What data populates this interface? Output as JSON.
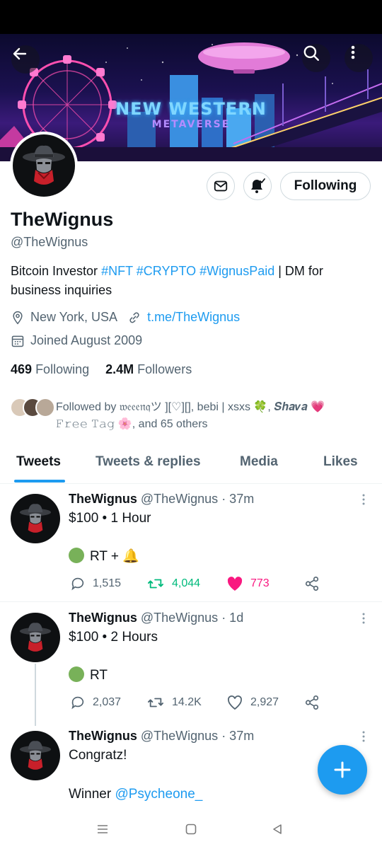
{
  "banner": {
    "title": "NEW WESTERN",
    "subtitle": "METAVERSE"
  },
  "header": {
    "back_icon": "arrow-left-icon",
    "search_icon": "search-icon",
    "more_icon": "more-vertical-icon"
  },
  "profile": {
    "name": "TheWignus",
    "handle": "@TheWignus",
    "follow_button": "Following",
    "bio": {
      "prefix": "Bitcoin Investor ",
      "tags": [
        "#NFT",
        "#CRYPTO",
        "#WignusPaid"
      ],
      "suffix": " | DM for business inquiries"
    },
    "location": "New York, USA",
    "website": "t.me/TheWignus",
    "joined": "Joined August 2009",
    "following_count": "469",
    "following_label": "Following",
    "followers_count": "2.4M",
    "followers_label": "Followers",
    "followed_by": {
      "prefix": "Followed by ",
      "name1": "𝔴𝔢𝔢𝔢𝔫𝔮ツ ][♡][]",
      "name2": "bebi | xsxs 🍀",
      "name3": "𝑺𝒉𝒂𝒗𝒂 💗",
      "name4": "𝙵𝚛𝚎𝚎 𝚃𝚊𝚐 🌸",
      "suffix": ", and 65 others"
    }
  },
  "tabs": [
    "Tweets",
    "Tweets & replies",
    "Media",
    "Likes"
  ],
  "tweets": [
    {
      "name": "TheWignus",
      "handle": "@TheWignus",
      "time": "· 37m",
      "line1": "$100 • 1 Hour",
      "line2": "RT + 🔔",
      "replies": "1,515",
      "retweets": "4,044",
      "likes": "773"
    },
    {
      "name": "TheWignus",
      "handle": "@TheWignus",
      "time": "· 1d",
      "line1": "$100 • 2 Hours",
      "line2": "RT",
      "replies": "2,037",
      "retweets": "14.2K",
      "likes": "2,927"
    },
    {
      "name": "TheWignus",
      "handle": "@TheWignus",
      "time": "· 37m",
      "line1": "Congratz!",
      "winner_prefix": "Winner ",
      "winner_mention": "@Psycheone_"
    }
  ],
  "colors": {
    "accent": "#1d9bf0",
    "retweet": "#00ba7c",
    "like": "#f91880",
    "text": "#0f1419",
    "muted": "#536471"
  }
}
